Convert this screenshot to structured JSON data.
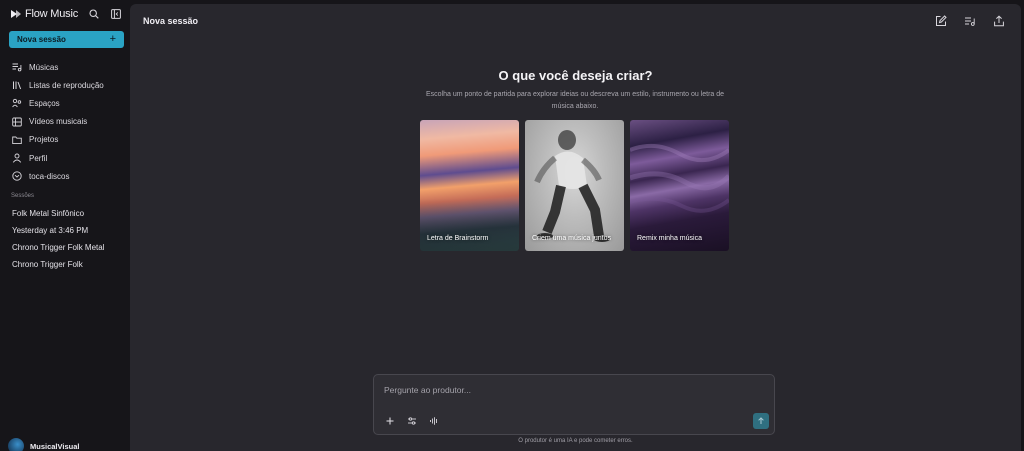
{
  "app": {
    "brand_name": "Flow Music",
    "icons": {
      "logo": "play-logo-icon",
      "search": "search-icon",
      "collapse": "sidebar-collapse-icon"
    }
  },
  "sidebar": {
    "new_session_label": "Nova sessão",
    "new_session_icon": "plus-icon",
    "nav": [
      {
        "label": "Músicas",
        "icon": "music-list-icon"
      },
      {
        "label": "Listas de reprodução",
        "icon": "library-icon"
      },
      {
        "label": "Espaços",
        "icon": "spaces-icon"
      },
      {
        "label": "Vídeos musicais",
        "icon": "video-grid-icon"
      },
      {
        "label": "Projetos",
        "icon": "folder-icon"
      },
      {
        "label": "Perfil",
        "icon": "person-icon"
      },
      {
        "label": "toca-discos",
        "icon": "record-icon"
      }
    ],
    "sessions_label": "Sessões",
    "sessions": [
      "Folk Metal Sinfônico",
      "Yesterday at 3:46 PM",
      "Chrono Trigger Folk Metal",
      "Chrono Trigger Folk"
    ],
    "user_name": "MusicalVisual"
  },
  "main": {
    "title": "Nova sessão",
    "top_actions": [
      "edit-icon",
      "queue-icon",
      "share-icon"
    ],
    "hero_title": "O que você deseja criar?",
    "hero_subtitle": "Escolha um ponto de partida para explorar ideias ou descreva um estilo, instrumento ou letra de música abaixo.",
    "cards": [
      {
        "label": "Letra de Brainstorm"
      },
      {
        "label": "Criem uma música juntos"
      },
      {
        "label": "Remix minha música"
      }
    ],
    "composer": {
      "placeholder": "Pergunte ao produtor...",
      "tools": [
        "plus-icon",
        "sliders-icon",
        "waveform-icon"
      ],
      "send_icon": "arrow-up-icon"
    },
    "disclaimer": "O produtor é uma IA e pode cometer erros."
  },
  "colors": {
    "accent": "#2aa3c4",
    "sidebar_bg": "#161519",
    "main_bg": "#28272d",
    "composer_bg": "#2f2e34",
    "send_button": "#2f6f80"
  }
}
